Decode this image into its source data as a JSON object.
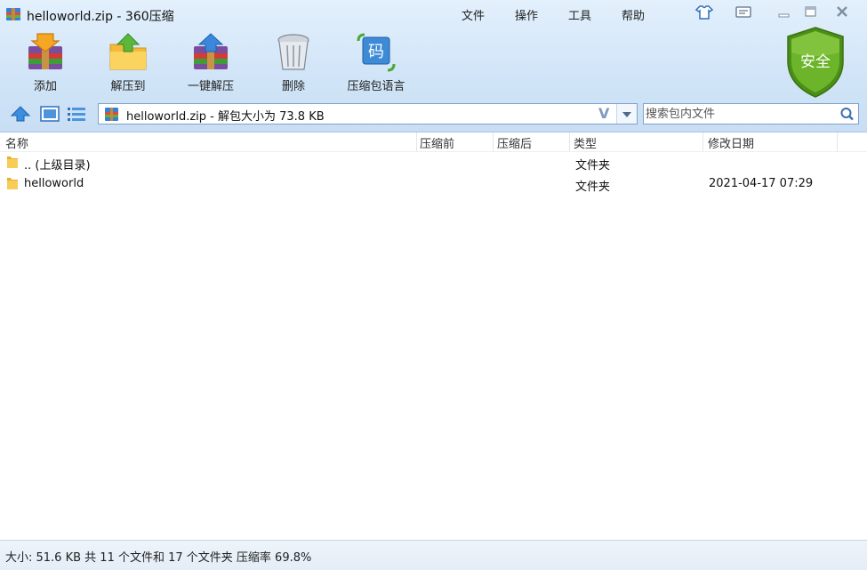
{
  "window": {
    "title": "helloworld.zip - 360压缩"
  },
  "menu": [
    "文件",
    "操作",
    "工具",
    "帮助"
  ],
  "toolbar": {
    "add": "添加",
    "extract_to": "解压到",
    "one_click_extract": "一键解压",
    "delete": "删除",
    "archive_language": "压缩包语言",
    "lang_badge": "码"
  },
  "security_badge": "安全",
  "address": {
    "text": "helloworld.zip - 解包大小为 73.8 KB",
    "v_mark": "V"
  },
  "search": {
    "placeholder": "搜索包内文件"
  },
  "columns": [
    "名称",
    "压缩前",
    "压缩后",
    "类型",
    "修改日期"
  ],
  "files": [
    {
      "name": ".. (上级目录)",
      "before": "",
      "after": "",
      "type": "文件夹",
      "modified": ""
    },
    {
      "name": "helloworld",
      "before": "",
      "after": "",
      "type": "文件夹",
      "modified": "2021-04-17 07:29"
    }
  ],
  "status": "大小: 51.6 KB 共 11 个文件和 17 个文件夹 压缩率 69.8%",
  "colors": {
    "accent": "#2e7bd1",
    "shield_green": "#5aa21d",
    "folder": "#f6c94f"
  }
}
